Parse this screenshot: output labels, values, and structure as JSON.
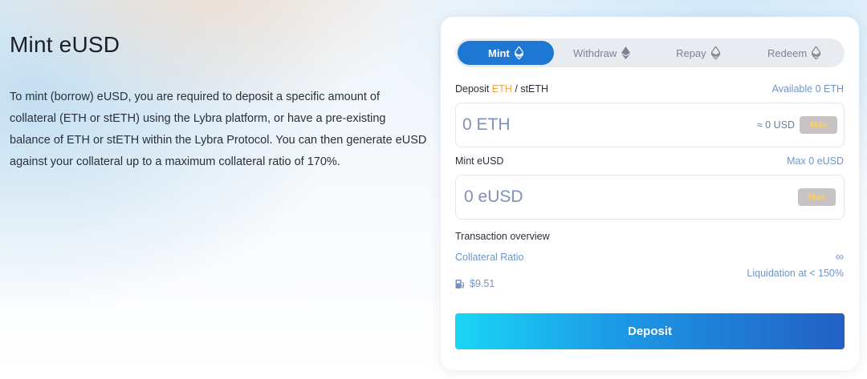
{
  "intro": {
    "title": "Mint eUSD",
    "description": "To mint (borrow) eUSD, you are required to deposit a specific amount of collateral (ETH or stETH) using the Lybra platform, or have a pre-existing balance of ETH or stETH within the Lybra Protocol. You can then generate eUSD against your collateral up to a maximum collateral ratio of 170%."
  },
  "tabs": [
    {
      "label": "Mint",
      "icon": "eth-icon",
      "active": true
    },
    {
      "label": "Withdraw",
      "icon": "eth-icon",
      "active": false
    },
    {
      "label": "Repay",
      "icon": "eth-icon",
      "active": false
    },
    {
      "label": "Redeem",
      "icon": "eth-icon",
      "active": false
    }
  ],
  "deposit": {
    "label_prefix": "Deposit",
    "label_eth": "ETH",
    "label_sep": "/",
    "label_steth": "stETH",
    "available": "Available 0 ETH",
    "value": "0 ETH",
    "approx": "≈ 0 USD",
    "max_label": "Max"
  },
  "mint": {
    "label": "Mint eUSD",
    "max": "Max 0 eUSD",
    "value": "0 eUSD",
    "max_label": "Max"
  },
  "overview": {
    "title": "Transaction overview",
    "collateral_ratio_label": "Collateral Ratio",
    "collateral_ratio_value": "∞",
    "liquidation": "Liquidation at < 150%",
    "gas_fee": "$9.51"
  },
  "action": {
    "deposit_label": "Deposit"
  },
  "colors": {
    "accent": "#1f77d4",
    "link": "#6f95c8",
    "highlight": "#f3a54a",
    "button_gradient_start": "#1ad6f6",
    "button_gradient_end": "#2260c4"
  }
}
